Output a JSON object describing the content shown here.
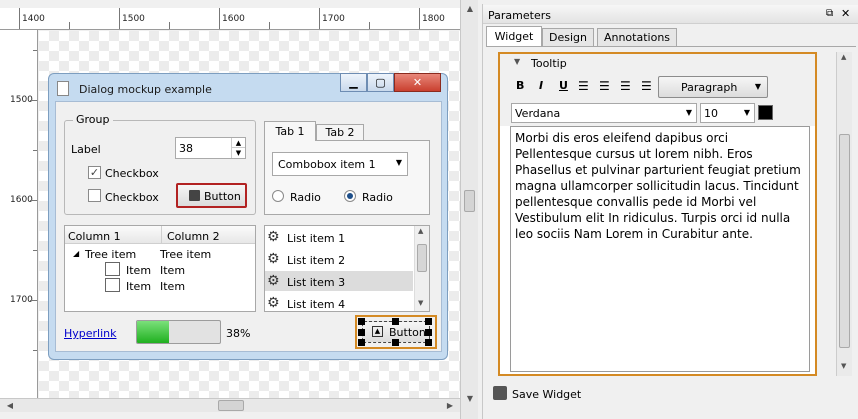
{
  "ruler": {
    "top_labels": [
      "1400",
      "1500",
      "1600",
      "1700",
      "1800"
    ],
    "left_labels": [
      "1500",
      "1600",
      "1700"
    ]
  },
  "dialog": {
    "title": "Dialog mockup example",
    "group_title": "Group",
    "label_text": "Label",
    "spin_value": "38",
    "checkbox1_label": "Checkbox",
    "checkbox2_label": "Checkbox",
    "button_label": "Button",
    "tab1": "Tab 1",
    "tab2": "Tab 2",
    "combo_value": "Combobox item 1",
    "radio1_label": "Radio",
    "radio2_label": "Radio",
    "tree": {
      "col1": "Column 1",
      "col2": "Column 2",
      "root_label": "Tree item",
      "root_value": "Tree item",
      "rows": [
        {
          "label": "Item",
          "value": "Item"
        },
        {
          "label": "Item",
          "value": "Item"
        }
      ]
    },
    "list_items": [
      "List item 1",
      "List item 2",
      "List item 3",
      "List item 4"
    ],
    "hyperlink": "Hyperlink",
    "progress_percent": 38,
    "progress_label": "38%",
    "bottom_button_label": "Button"
  },
  "params": {
    "title": "Parameters",
    "tabs": [
      "Widget",
      "Design",
      "Annotations"
    ],
    "section": "Tooltip",
    "format_buttons": [
      "B",
      "I",
      "U"
    ],
    "paragraph_value": "Paragraph",
    "font_value": "Verdana",
    "size_value": "10",
    "color": "#000000",
    "tooltip_text": "Morbi dis eros eleifend dapibus orci Pellentesque cursus ut lorem nibh. Eros Phasellus et pulvinar parturient feugiat pretium magna ullamcorper sollicitudin lacus. Tincidunt pellentesque convallis pede id Morbi vel Vestibulum elit In ridiculus. Turpis orci id nulla leo sociis Nam Lorem in Curabitur ante.",
    "save_label": "Save Widget"
  },
  "colors": {
    "selection_orange": "#d48a24",
    "button_selected": "#b22222",
    "progress_green": "#2fc42f",
    "hyperlink": "#0000cc"
  }
}
